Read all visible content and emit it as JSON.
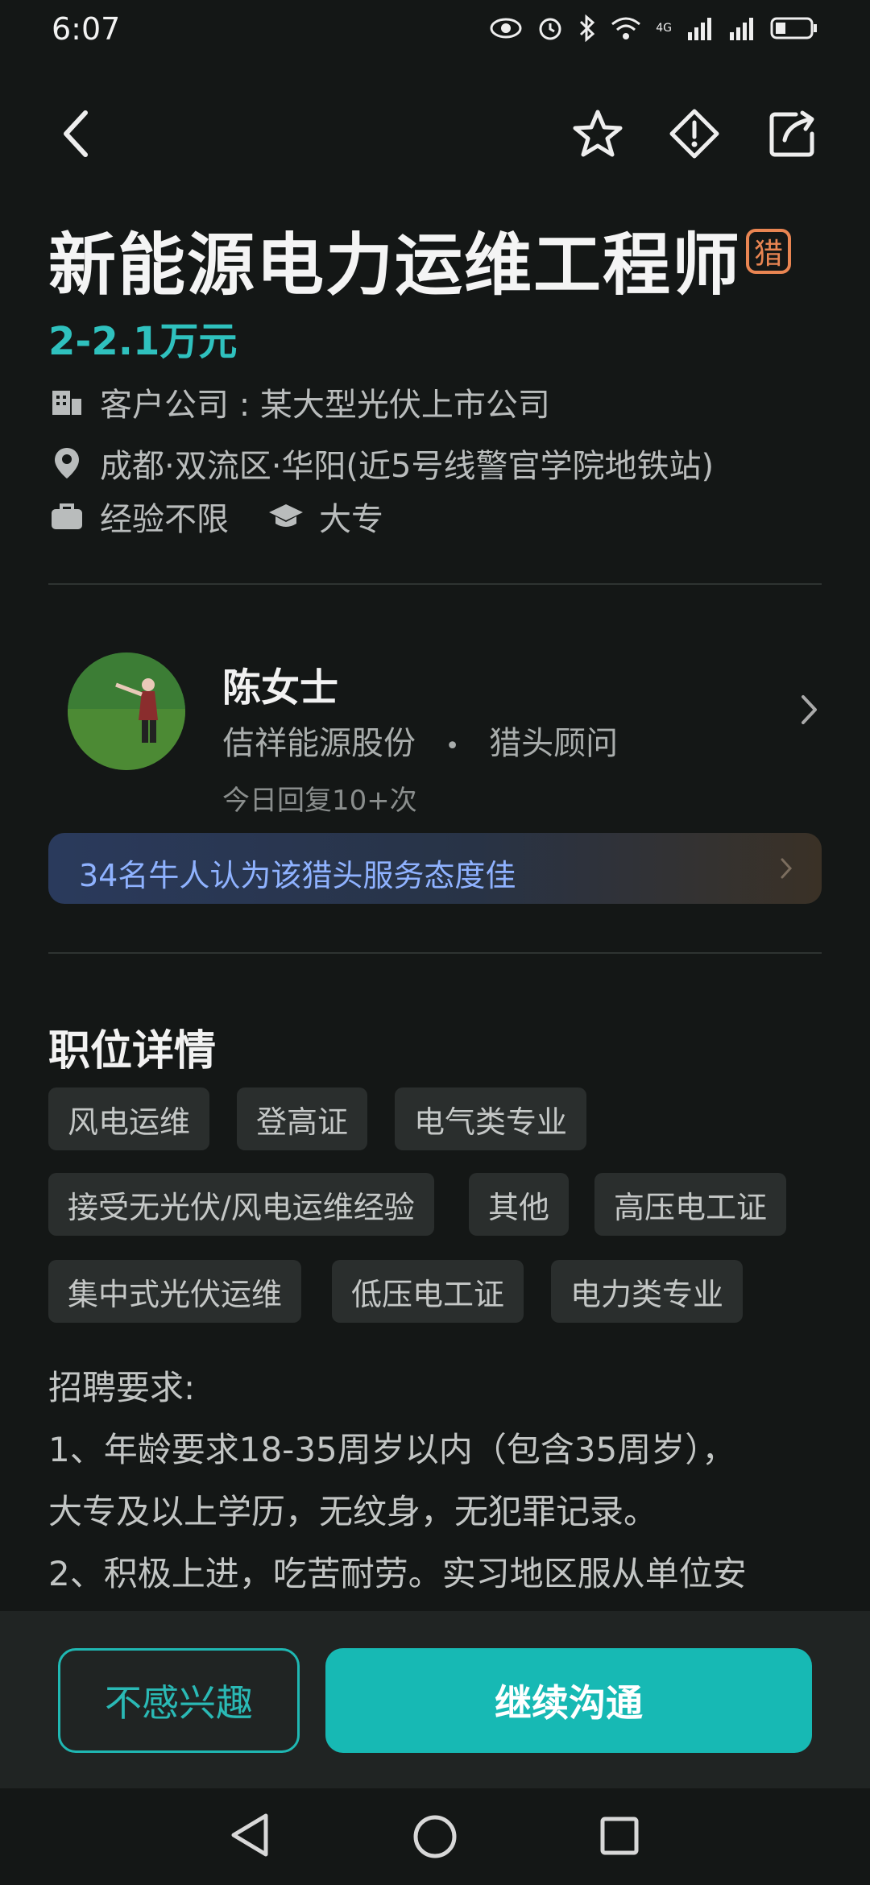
{
  "status": {
    "time": "6:07",
    "network_label": "4G"
  },
  "job": {
    "title": "新能源电力运维工程师",
    "badge": "猎",
    "salary": "2-2.1万元",
    "client": "客户公司 : 某大型光伏上市公司",
    "location": "成都·双流区·华阳(近5号线警官学院地铁站)",
    "experience": "经验不限",
    "education": "大专"
  },
  "recruiter": {
    "name": "陈女士",
    "company": "佶祥能源股份",
    "separator": "•",
    "role": "猎头顾问",
    "reply": "今日回复10+次",
    "banner": "34名牛人认为该猎头服务态度佳"
  },
  "details": {
    "section_title": "职位详情",
    "tags": [
      "风电运维",
      "登高证",
      "电气类专业",
      "接受无光伏/风电运维经验",
      "其他",
      "高压电工证",
      "集中式光伏运维",
      "低压电工证",
      "电力类专业"
    ],
    "description": [
      "招聘要求:",
      "1、年龄要求18-35周岁以内（包含35周岁），",
      "大专及以上学历，无纹身，无犯罪记录。",
      "2、积极上进，吃苦耐劳。实习地区服从单位安"
    ]
  },
  "actions": {
    "not_interested": "不感兴趣",
    "continue_chat": "继续沟通"
  },
  "colors": {
    "background": "#141716",
    "accent": "#17b9b4",
    "salary": "#2fc1be",
    "badge": "#e98552",
    "banner_text": "#8fb2ff"
  },
  "icons": [
    "back-icon",
    "star-icon",
    "warning-icon",
    "share-icon",
    "building-icon",
    "location-pin-icon",
    "briefcase-icon",
    "graduation-cap-icon",
    "chevron-right-icon"
  ]
}
